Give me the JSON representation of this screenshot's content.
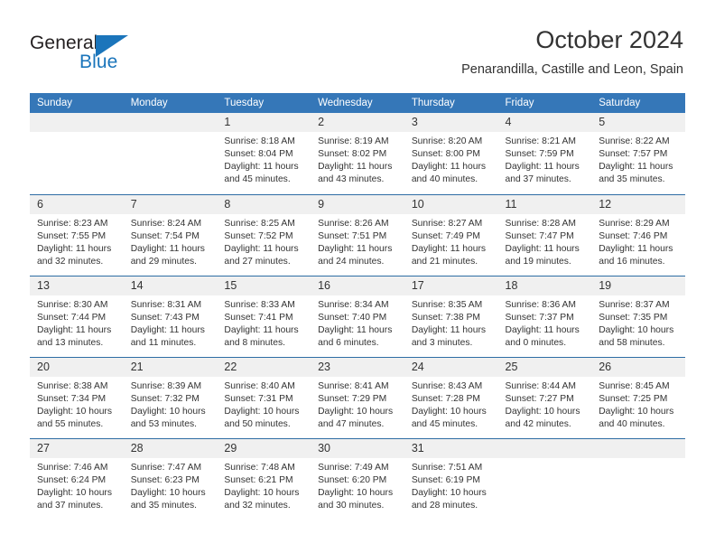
{
  "logo": {
    "word1": "General",
    "word2": "Blue",
    "triangle_color": "#1b75bb"
  },
  "header": {
    "title": "October 2024",
    "subtitle": "Penarandilla, Castille and Leon, Spain",
    "header_bg_color": "#3577b8",
    "row_divider_color": "#2e6da4",
    "daynum_bg_color": "#f0f0f0"
  },
  "weekday_headers": [
    "Sunday",
    "Monday",
    "Tuesday",
    "Wednesday",
    "Thursday",
    "Friday",
    "Saturday"
  ],
  "labels": {
    "sunrise_prefix": "Sunrise:",
    "sunset_prefix": "Sunset:",
    "daylight_prefix": "Daylight:"
  },
  "weeks": [
    [
      {
        "day": "",
        "sunrise": "",
        "sunset": "",
        "daylight_line1": "",
        "daylight_line2": ""
      },
      {
        "day": "",
        "sunrise": "",
        "sunset": "",
        "daylight_line1": "",
        "daylight_line2": ""
      },
      {
        "day": "1",
        "sunrise": "Sunrise: 8:18 AM",
        "sunset": "Sunset: 8:04 PM",
        "daylight_line1": "Daylight: 11 hours",
        "daylight_line2": "and 45 minutes."
      },
      {
        "day": "2",
        "sunrise": "Sunrise: 8:19 AM",
        "sunset": "Sunset: 8:02 PM",
        "daylight_line1": "Daylight: 11 hours",
        "daylight_line2": "and 43 minutes."
      },
      {
        "day": "3",
        "sunrise": "Sunrise: 8:20 AM",
        "sunset": "Sunset: 8:00 PM",
        "daylight_line1": "Daylight: 11 hours",
        "daylight_line2": "and 40 minutes."
      },
      {
        "day": "4",
        "sunrise": "Sunrise: 8:21 AM",
        "sunset": "Sunset: 7:59 PM",
        "daylight_line1": "Daylight: 11 hours",
        "daylight_line2": "and 37 minutes."
      },
      {
        "day": "5",
        "sunrise": "Sunrise: 8:22 AM",
        "sunset": "Sunset: 7:57 PM",
        "daylight_line1": "Daylight: 11 hours",
        "daylight_line2": "and 35 minutes."
      }
    ],
    [
      {
        "day": "6",
        "sunrise": "Sunrise: 8:23 AM",
        "sunset": "Sunset: 7:55 PM",
        "daylight_line1": "Daylight: 11 hours",
        "daylight_line2": "and 32 minutes."
      },
      {
        "day": "7",
        "sunrise": "Sunrise: 8:24 AM",
        "sunset": "Sunset: 7:54 PM",
        "daylight_line1": "Daylight: 11 hours",
        "daylight_line2": "and 29 minutes."
      },
      {
        "day": "8",
        "sunrise": "Sunrise: 8:25 AM",
        "sunset": "Sunset: 7:52 PM",
        "daylight_line1": "Daylight: 11 hours",
        "daylight_line2": "and 27 minutes."
      },
      {
        "day": "9",
        "sunrise": "Sunrise: 8:26 AM",
        "sunset": "Sunset: 7:51 PM",
        "daylight_line1": "Daylight: 11 hours",
        "daylight_line2": "and 24 minutes."
      },
      {
        "day": "10",
        "sunrise": "Sunrise: 8:27 AM",
        "sunset": "Sunset: 7:49 PM",
        "daylight_line1": "Daylight: 11 hours",
        "daylight_line2": "and 21 minutes."
      },
      {
        "day": "11",
        "sunrise": "Sunrise: 8:28 AM",
        "sunset": "Sunset: 7:47 PM",
        "daylight_line1": "Daylight: 11 hours",
        "daylight_line2": "and 19 minutes."
      },
      {
        "day": "12",
        "sunrise": "Sunrise: 8:29 AM",
        "sunset": "Sunset: 7:46 PM",
        "daylight_line1": "Daylight: 11 hours",
        "daylight_line2": "and 16 minutes."
      }
    ],
    [
      {
        "day": "13",
        "sunrise": "Sunrise: 8:30 AM",
        "sunset": "Sunset: 7:44 PM",
        "daylight_line1": "Daylight: 11 hours",
        "daylight_line2": "and 13 minutes."
      },
      {
        "day": "14",
        "sunrise": "Sunrise: 8:31 AM",
        "sunset": "Sunset: 7:43 PM",
        "daylight_line1": "Daylight: 11 hours",
        "daylight_line2": "and 11 minutes."
      },
      {
        "day": "15",
        "sunrise": "Sunrise: 8:33 AM",
        "sunset": "Sunset: 7:41 PM",
        "daylight_line1": "Daylight: 11 hours",
        "daylight_line2": "and 8 minutes."
      },
      {
        "day": "16",
        "sunrise": "Sunrise: 8:34 AM",
        "sunset": "Sunset: 7:40 PM",
        "daylight_line1": "Daylight: 11 hours",
        "daylight_line2": "and 6 minutes."
      },
      {
        "day": "17",
        "sunrise": "Sunrise: 8:35 AM",
        "sunset": "Sunset: 7:38 PM",
        "daylight_line1": "Daylight: 11 hours",
        "daylight_line2": "and 3 minutes."
      },
      {
        "day": "18",
        "sunrise": "Sunrise: 8:36 AM",
        "sunset": "Sunset: 7:37 PM",
        "daylight_line1": "Daylight: 11 hours",
        "daylight_line2": "and 0 minutes."
      },
      {
        "day": "19",
        "sunrise": "Sunrise: 8:37 AM",
        "sunset": "Sunset: 7:35 PM",
        "daylight_line1": "Daylight: 10 hours",
        "daylight_line2": "and 58 minutes."
      }
    ],
    [
      {
        "day": "20",
        "sunrise": "Sunrise: 8:38 AM",
        "sunset": "Sunset: 7:34 PM",
        "daylight_line1": "Daylight: 10 hours",
        "daylight_line2": "and 55 minutes."
      },
      {
        "day": "21",
        "sunrise": "Sunrise: 8:39 AM",
        "sunset": "Sunset: 7:32 PM",
        "daylight_line1": "Daylight: 10 hours",
        "daylight_line2": "and 53 minutes."
      },
      {
        "day": "22",
        "sunrise": "Sunrise: 8:40 AM",
        "sunset": "Sunset: 7:31 PM",
        "daylight_line1": "Daylight: 10 hours",
        "daylight_line2": "and 50 minutes."
      },
      {
        "day": "23",
        "sunrise": "Sunrise: 8:41 AM",
        "sunset": "Sunset: 7:29 PM",
        "daylight_line1": "Daylight: 10 hours",
        "daylight_line2": "and 47 minutes."
      },
      {
        "day": "24",
        "sunrise": "Sunrise: 8:43 AM",
        "sunset": "Sunset: 7:28 PM",
        "daylight_line1": "Daylight: 10 hours",
        "daylight_line2": "and 45 minutes."
      },
      {
        "day": "25",
        "sunrise": "Sunrise: 8:44 AM",
        "sunset": "Sunset: 7:27 PM",
        "daylight_line1": "Daylight: 10 hours",
        "daylight_line2": "and 42 minutes."
      },
      {
        "day": "26",
        "sunrise": "Sunrise: 8:45 AM",
        "sunset": "Sunset: 7:25 PM",
        "daylight_line1": "Daylight: 10 hours",
        "daylight_line2": "and 40 minutes."
      }
    ],
    [
      {
        "day": "27",
        "sunrise": "Sunrise: 7:46 AM",
        "sunset": "Sunset: 6:24 PM",
        "daylight_line1": "Daylight: 10 hours",
        "daylight_line2": "and 37 minutes."
      },
      {
        "day": "28",
        "sunrise": "Sunrise: 7:47 AM",
        "sunset": "Sunset: 6:23 PM",
        "daylight_line1": "Daylight: 10 hours",
        "daylight_line2": "and 35 minutes."
      },
      {
        "day": "29",
        "sunrise": "Sunrise: 7:48 AM",
        "sunset": "Sunset: 6:21 PM",
        "daylight_line1": "Daylight: 10 hours",
        "daylight_line2": "and 32 minutes."
      },
      {
        "day": "30",
        "sunrise": "Sunrise: 7:49 AM",
        "sunset": "Sunset: 6:20 PM",
        "daylight_line1": "Daylight: 10 hours",
        "daylight_line2": "and 30 minutes."
      },
      {
        "day": "31",
        "sunrise": "Sunrise: 7:51 AM",
        "sunset": "Sunset: 6:19 PM",
        "daylight_line1": "Daylight: 10 hours",
        "daylight_line2": "and 28 minutes."
      },
      {
        "day": "",
        "sunrise": "",
        "sunset": "",
        "daylight_line1": "",
        "daylight_line2": ""
      },
      {
        "day": "",
        "sunrise": "",
        "sunset": "",
        "daylight_line1": "",
        "daylight_line2": ""
      }
    ]
  ]
}
